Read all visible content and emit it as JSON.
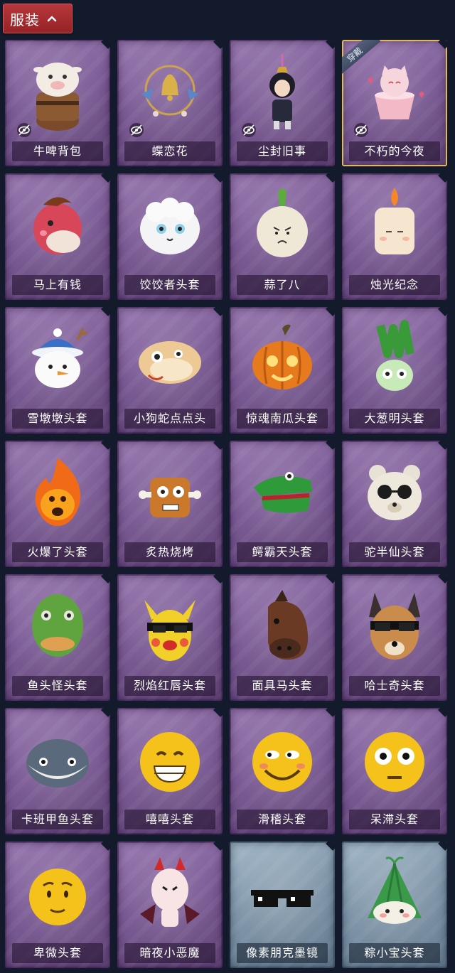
{
  "header": {
    "title": "服装"
  },
  "worn_label": "穿戴",
  "items": [
    {
      "name": "牛啤背包",
      "frame": "purple",
      "hidden": true,
      "art": "cow-mug"
    },
    {
      "name": "蝶恋花",
      "frame": "purple",
      "hidden": true,
      "art": "bell-wreath"
    },
    {
      "name": "尘封旧事",
      "frame": "purple",
      "hidden": true,
      "art": "charm-doll"
    },
    {
      "name": "不朽的今夜",
      "frame": "purple",
      "hidden": true,
      "worn": true,
      "art": "cat-cup"
    },
    {
      "name": "马上有钱",
      "frame": "purple",
      "art": "horse-head"
    },
    {
      "name": "饺饺者头套",
      "frame": "purple",
      "art": "dumpling-head"
    },
    {
      "name": "蒜了八",
      "frame": "purple",
      "art": "garlic-head"
    },
    {
      "name": "烛光纪念",
      "frame": "purple",
      "art": "candle-head"
    },
    {
      "name": "雪墩墩头套",
      "frame": "purple",
      "art": "snowman-head"
    },
    {
      "name": "小狗蛇点点头",
      "frame": "purple",
      "art": "snake-dog-head"
    },
    {
      "name": "惊魂南瓜头套",
      "frame": "purple",
      "art": "pumpkin-head"
    },
    {
      "name": "大葱明头套",
      "frame": "purple",
      "art": "scallion-head"
    },
    {
      "name": "火爆了头套",
      "frame": "purple",
      "art": "fire-head"
    },
    {
      "name": "炙热烧烤",
      "frame": "purple",
      "art": "bbq-head"
    },
    {
      "name": "鳄霸天头套",
      "frame": "purple",
      "art": "crocodile-head"
    },
    {
      "name": "驼半仙头套",
      "frame": "purple",
      "art": "bear-head"
    },
    {
      "name": "鱼头怪头套",
      "frame": "purple",
      "art": "fish-head"
    },
    {
      "name": "烈焰红唇头套",
      "frame": "purple",
      "art": "pikachu-head"
    },
    {
      "name": "面具马头套",
      "frame": "purple",
      "art": "horse-mask"
    },
    {
      "name": "哈士奇头套",
      "frame": "purple",
      "art": "husky-head"
    },
    {
      "name": "卡班甲鱼头套",
      "frame": "purple",
      "art": "blowfish-head"
    },
    {
      "name": "嘻嘻头套",
      "frame": "purple",
      "art": "grin-head"
    },
    {
      "name": "滑稽头套",
      "frame": "purple",
      "art": "smirk-head"
    },
    {
      "name": "呆滞头套",
      "frame": "purple",
      "art": "stare-head"
    },
    {
      "name": "卑微头套",
      "frame": "purple",
      "art": "humble-head"
    },
    {
      "name": "暗夜小恶魔",
      "frame": "purple",
      "art": "devil-head"
    },
    {
      "name": "像素朋克墨镜",
      "frame": "blue",
      "art": "pixel-glasses"
    },
    {
      "name": "粽小宝头套",
      "frame": "blue",
      "art": "zongzi-head"
    }
  ]
}
